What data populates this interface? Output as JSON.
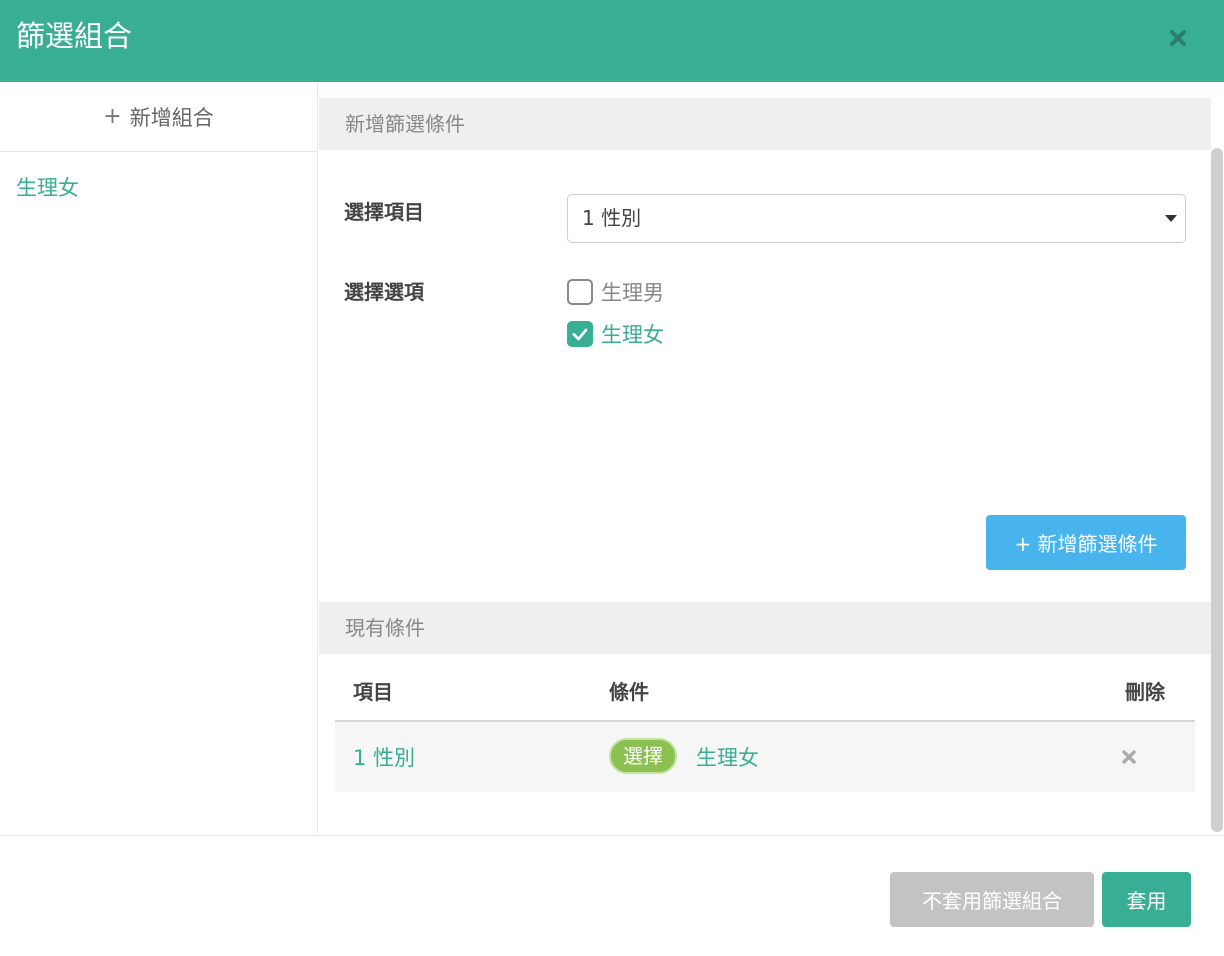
{
  "header": {
    "title": "篩選組合",
    "close_icon": "close-icon"
  },
  "sidebar": {
    "add_label": "新增組合",
    "add_icon": "plus-icon",
    "items": [
      {
        "label": "生理女"
      }
    ]
  },
  "new_condition": {
    "section_title": "新增篩選條件",
    "item_label": "選擇項目",
    "item_select_value": "1 性別",
    "option_label": "選擇選項",
    "options": [
      {
        "label": "生理男",
        "checked": false
      },
      {
        "label": "生理女",
        "checked": true
      }
    ],
    "add_button_label": "+ 新增篩選條件"
  },
  "existing_conditions": {
    "section_title": "現有條件",
    "columns": [
      "項目",
      "條件",
      "刪除"
    ],
    "rows": [
      {
        "item": "1 性別",
        "tag": "選擇",
        "value": "生理女"
      }
    ]
  },
  "footer": {
    "no_apply_label": "不套用篩選組合",
    "apply_label": "套用"
  },
  "colors": {
    "brand": "#38ae94",
    "accent_blue": "#47b4ee",
    "tag_green": "#8cc152",
    "disabled": "#c3c3c3"
  }
}
